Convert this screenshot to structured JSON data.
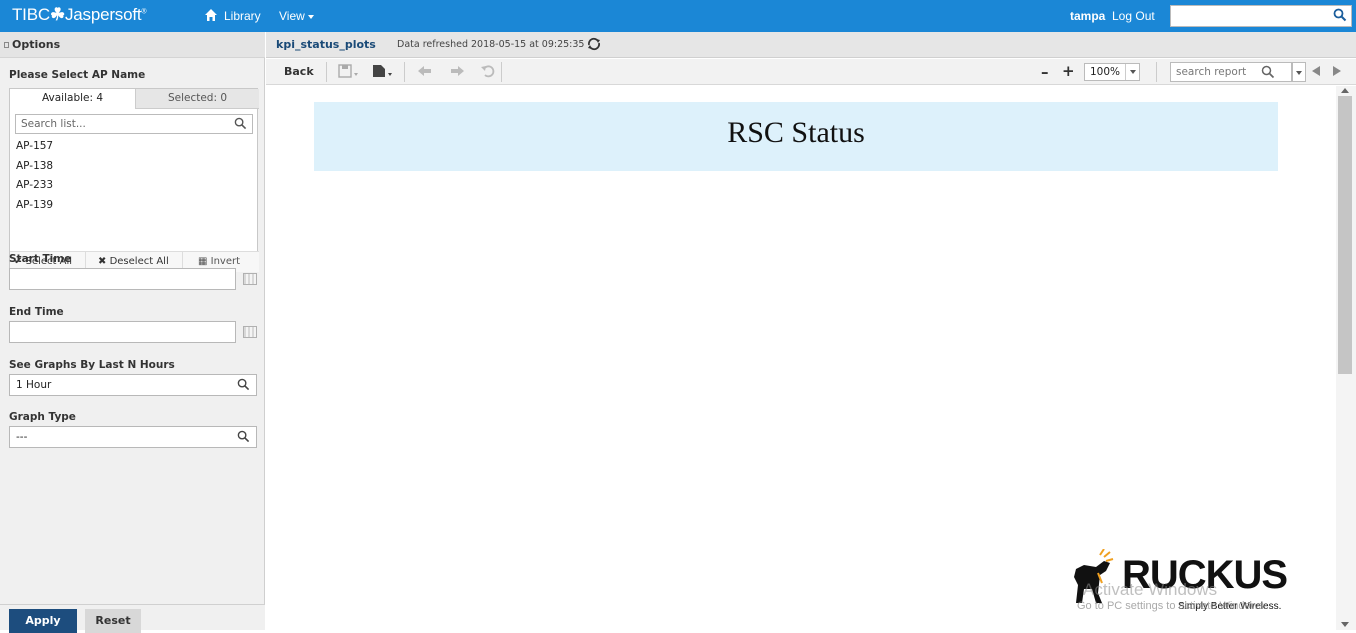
{
  "topbar": {
    "brand": "TIBC",
    "brand_rest": "Jaspersoft",
    "library": "Library",
    "view": "View",
    "user": "tampa",
    "logout": "Log Out",
    "search_value": ""
  },
  "options": {
    "title": "Options",
    "ap_label": "Please Select AP Name",
    "tab_available": "Available: 4",
    "tab_selected": "Selected: 0",
    "list_search_placeholder": "Search list...",
    "ap_items": [
      "AP-157",
      "AP-138",
      "AP-233",
      "AP-139"
    ],
    "select_all": "Select All",
    "deselect_all": "Deselect All",
    "invert": "Invert",
    "start_time_label": "Start Time",
    "start_time_value": "",
    "end_time_label": "End Time",
    "end_time_value": "",
    "hours_label": "See Graphs By Last N Hours",
    "hours_value": "1 Hour",
    "graph_type_label": "Graph Type",
    "graph_type_value": "---",
    "apply": "Apply",
    "reset": "Reset"
  },
  "report": {
    "name": "kpi_status_plots",
    "refreshed": "Data refreshed 2018-05-15 at 09:25:35",
    "back": "Back",
    "zoom": "100%",
    "search_placeholder": "search report",
    "banner_title": "RSC Status"
  },
  "logo": {
    "word": "RUCKUS",
    "tagline": "Simply Better Wireless."
  },
  "watermark": {
    "line1": "Activate Windows",
    "line2": "Go to PC settings to activate Windows."
  },
  "colors": {
    "topbar": "#1b87d6",
    "apply": "#1d4d7e",
    "banner": "#ddf1fb"
  }
}
